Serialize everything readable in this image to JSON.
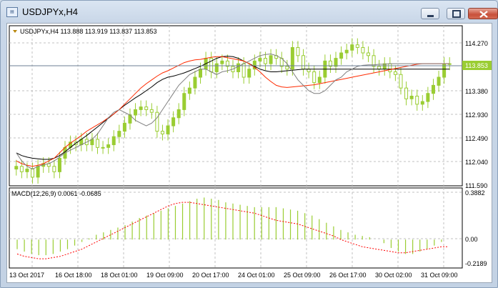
{
  "window": {
    "title": "USDJPYx,H4"
  },
  "main_chart": {
    "header": "USDJPYx,H4  113.888 113.919 113.837 113.853",
    "price_levels": [
      "114.270",
      "113.380",
      "112.930",
      "112.490",
      "112.040",
      "111.590"
    ],
    "current_price": "113.853",
    "colors": {
      "bull": "#9acd32",
      "bear": "#9acd32",
      "ma_fast": "#7f7f7f",
      "ma_mid": "#ff2a00",
      "ma_slow": "#000000",
      "grid": "#c0c0c0",
      "axis_text": "#000000",
      "price_tag_bg": "#9acd32"
    }
  },
  "macd": {
    "header": "MACD(12,26,9) 0.0061 -0.0685",
    "levels": [
      "0.3882",
      "0.00",
      "-0.2189"
    ],
    "colors": {
      "histogram": "#9acd32",
      "signal": "#ff0000"
    }
  },
  "time_axis": [
    "13 Oct 2017",
    "16 Oct 18:00",
    "18 Oct 01:00",
    "19 Oct 09:00",
    "20 Oct 17:00",
    "24 Oct 01:00",
    "25 Oct 09:00",
    "26 Oct 17:00",
    "30 Oct 02:00",
    "31 Oct 09:00"
  ],
  "chart_data": [
    {
      "type": "candlestick",
      "title": "USDJPYx,H4",
      "last_bar": {
        "open": 113.888,
        "high": 113.919,
        "low": 113.837,
        "close": 113.853
      },
      "ylim": [
        111.59,
        114.5
      ],
      "close": [
        111.95,
        111.85,
        111.9,
        111.75,
        111.95,
        112.0,
        111.95,
        111.85,
        112.1,
        112.3,
        112.4,
        112.35,
        112.45,
        112.35,
        112.45,
        112.3,
        112.3,
        112.35,
        112.5,
        112.6,
        112.75,
        112.9,
        113.0,
        113.05,
        113.0,
        112.95,
        112.6,
        112.55,
        112.7,
        112.85,
        113.0,
        113.3,
        113.4,
        113.6,
        113.75,
        113.95,
        113.7,
        113.85,
        113.9,
        113.8,
        113.7,
        113.85,
        113.6,
        113.75,
        113.9,
        113.95,
        113.85,
        114.0,
        113.95,
        113.8,
        113.75,
        114.15,
        114.0,
        113.75,
        113.7,
        113.5,
        113.6,
        113.9,
        113.8,
        113.95,
        114.05,
        114.1,
        114.2,
        114.15,
        114.05,
        114.0,
        113.8,
        113.75,
        113.85,
        113.7,
        113.65,
        113.4,
        113.2,
        113.25,
        113.1,
        113.15,
        113.3,
        113.45,
        113.6,
        113.85,
        113.85
      ],
      "ma_fast": [
        112.2,
        112.05,
        111.95,
        111.9,
        111.95,
        111.98,
        112.0,
        112.05,
        112.12,
        112.2,
        112.25,
        112.3,
        112.35,
        112.4,
        112.45,
        112.55,
        112.7,
        112.85,
        112.95,
        113.0,
        112.95,
        112.9,
        112.8,
        112.75,
        112.7,
        112.75,
        112.85,
        113.0,
        113.15,
        113.3,
        113.45,
        113.55,
        113.65,
        113.7,
        113.75,
        113.75,
        113.7,
        113.65,
        113.7,
        113.72,
        113.75,
        113.8,
        113.85,
        113.9,
        113.95,
        114.0,
        114.02,
        114.03,
        114.0,
        113.95,
        113.85,
        113.7,
        113.55,
        113.45,
        113.35,
        113.3,
        113.3,
        113.35,
        113.45,
        113.55,
        113.6,
        113.7,
        113.75,
        113.8,
        113.82,
        113.83,
        113.83,
        113.84,
        113.84,
        113.85,
        113.85,
        113.85,
        113.85,
        113.85,
        113.85,
        113.85,
        113.85,
        113.85,
        113.85,
        113.85,
        113.85
      ],
      "ma_mid": [
        112.05,
        112.0,
        111.97,
        111.95,
        111.97,
        112.0,
        112.05,
        112.1,
        112.2,
        112.3,
        112.38,
        112.45,
        112.52,
        112.6,
        112.66,
        112.72,
        112.78,
        112.85,
        112.92,
        113.0,
        113.1,
        113.2,
        113.3,
        113.4,
        113.48,
        113.55,
        113.62,
        113.68,
        113.72,
        113.77,
        113.82,
        113.87,
        113.9,
        113.92,
        113.93,
        113.95,
        113.97,
        113.98,
        113.98,
        113.96,
        113.94,
        113.92,
        113.9,
        113.85,
        113.78,
        113.7,
        113.6,
        113.52,
        113.45,
        113.42,
        113.41,
        113.42,
        113.43,
        113.44,
        113.45,
        113.46,
        113.48,
        113.5,
        113.52,
        113.54,
        113.56,
        113.58,
        113.6,
        113.62,
        113.64,
        113.66,
        113.68,
        113.7,
        113.72,
        113.74,
        113.76,
        113.78,
        113.8,
        113.82,
        113.84,
        113.85,
        113.85,
        113.85,
        113.85,
        113.85,
        113.85
      ],
      "ma_slow": [
        112.2,
        112.15,
        112.12,
        112.1,
        112.09,
        112.08,
        112.08,
        112.1,
        112.15,
        112.22,
        112.3,
        112.38,
        112.45,
        112.52,
        112.6,
        112.68,
        112.76,
        112.84,
        112.92,
        113.0,
        113.08,
        113.15,
        113.22,
        113.28,
        113.35,
        113.42,
        113.5,
        113.56,
        113.6,
        113.62,
        113.65,
        113.68,
        113.72,
        113.76,
        113.8,
        113.85,
        113.9,
        113.95,
        113.98,
        113.99,
        113.98,
        113.95,
        113.9,
        113.85,
        113.8,
        113.75,
        113.72,
        113.7,
        113.7,
        113.71,
        113.72,
        113.73,
        113.74,
        113.75,
        113.75,
        113.75,
        113.75,
        113.75,
        113.75,
        113.75,
        113.75,
        113.75,
        113.75,
        113.75,
        113.75,
        113.75,
        113.75,
        113.75,
        113.75,
        113.75,
        113.75,
        113.75,
        113.75,
        113.75,
        113.75,
        113.75,
        113.75,
        113.75,
        113.75,
        113.75,
        113.75
      ]
    },
    {
      "type": "histogram",
      "title": "MACD(12,26,9)",
      "ylim": [
        -0.2189,
        0.3882
      ],
      "values": [
        -0.08,
        -0.1,
        -0.12,
        -0.13,
        -0.13,
        -0.12,
        -0.1,
        -0.08,
        -0.05,
        -0.02,
        0.01,
        0.04,
        0.06,
        0.08,
        0.1,
        0.12,
        0.15,
        0.18,
        0.2,
        0.22,
        0.24,
        0.26,
        0.28,
        0.3,
        0.32,
        0.34,
        0.35,
        0.34,
        0.33,
        0.31,
        0.3,
        0.29,
        0.28,
        0.27,
        0.27,
        0.27,
        0.27,
        0.26,
        0.25,
        0.24,
        0.22,
        0.2,
        0.17,
        0.14,
        0.11,
        0.08,
        0.06,
        0.04,
        0.03,
        0.02,
        0.0,
        -0.03,
        -0.07,
        -0.1,
        -0.12,
        -0.12,
        -0.1,
        -0.08,
        -0.05,
        -0.02,
        0.0
      ],
      "signal": [
        -0.12,
        -0.14,
        -0.15,
        -0.16,
        -0.16,
        -0.15,
        -0.14,
        -0.12,
        -0.1,
        -0.08,
        -0.05,
        -0.02,
        0.01,
        0.04,
        0.07,
        0.1,
        0.13,
        0.16,
        0.19,
        0.22,
        0.25,
        0.28,
        0.3,
        0.31,
        0.31,
        0.3,
        0.29,
        0.28,
        0.27,
        0.26,
        0.25,
        0.24,
        0.23,
        0.22,
        0.2,
        0.18,
        0.16,
        0.15,
        0.14,
        0.13,
        0.11,
        0.09,
        0.07,
        0.05,
        0.03,
        0.0,
        -0.02,
        -0.04,
        -0.06,
        -0.07,
        -0.08,
        -0.09,
        -0.1,
        -0.11,
        -0.11,
        -0.1,
        -0.09,
        -0.08,
        -0.07,
        -0.06,
        -0.06
      ]
    }
  ]
}
